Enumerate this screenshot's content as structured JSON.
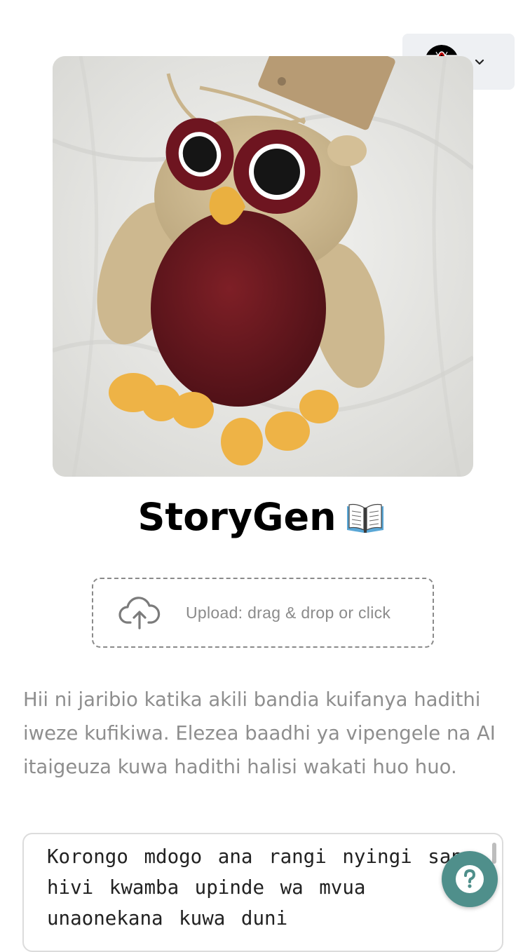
{
  "language_selector": {
    "flag_icon": "kenya-flag-icon",
    "chevron_icon": "chevron-down-icon"
  },
  "hero_image": {
    "icon": "crocheted-owl-image"
  },
  "header": {
    "title": "StoryGen",
    "title_icon": "open-book-icon"
  },
  "upload": {
    "icon": "cloud-upload-icon",
    "label": "Upload: drag & drop or click"
  },
  "description": "Hii ni jaribio katika akili bandia kuifanya hadithi iweze kufikiwa. Elezea baadhi ya vipengele na AI itaigeuza kuwa hadithi halisi wakati huo huo.",
  "story_input": {
    "value": "Korongo mdogo ana rangi nyingi sana hivi kwamba upinde wa mvua unaonekana kuwa duni"
  },
  "help_button": {
    "icon": "question-mark-icon"
  },
  "colors": {
    "accent": "#4f8f8b",
    "muted_text": "#8e8e8e",
    "selector_bg": "#eef0f3"
  }
}
